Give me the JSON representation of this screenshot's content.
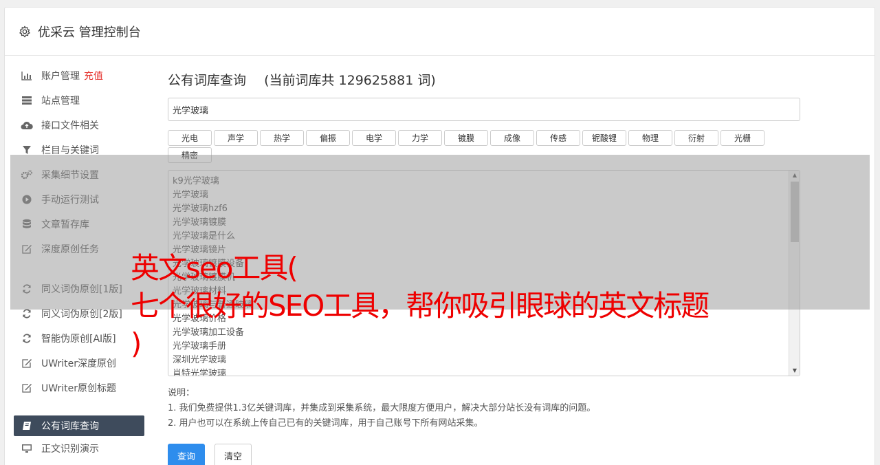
{
  "header": {
    "title": "优采云 管理控制台",
    "icon": "gear-icon"
  },
  "sidebar": {
    "items": [
      {
        "label": "账户管理",
        "extra": "充值",
        "icon": "bar-chart-icon"
      },
      {
        "label": "站点管理",
        "icon": "server-icon"
      },
      {
        "label": "接口文件相关",
        "icon": "cloud-upload-icon"
      },
      {
        "label": "栏目与关键词",
        "icon": "filter-icon"
      },
      {
        "label": "采集细节设置",
        "icon": "gears-icon"
      },
      {
        "label": "手动运行测试",
        "icon": "play-circle-icon"
      },
      {
        "label": "文章暂存库",
        "icon": "database-icon"
      },
      {
        "label": "深度原创任务",
        "icon": "edit-icon"
      },
      {
        "label": "同义词伪原创[1版]",
        "icon": "refresh-icon"
      },
      {
        "label": "同义词伪原创[2版]",
        "icon": "refresh-icon"
      },
      {
        "label": "智能伪原创[AI版]",
        "icon": "refresh-icon"
      },
      {
        "label": "UWriter深度原创",
        "icon": "edit-icon"
      },
      {
        "label": "UWriter原创标题",
        "icon": "edit-icon"
      },
      {
        "label": "公有词库查询",
        "icon": "book-icon",
        "active": true
      },
      {
        "label": "正文识别演示",
        "icon": "monitor-icon"
      }
    ]
  },
  "main": {
    "title": "公有词库查询",
    "count_text": "(当前词库共 129625881 词)",
    "search_value": "光学玻璃",
    "tags": [
      "光电",
      "声学",
      "热学",
      "偏振",
      "电学",
      "力学",
      "镀膜",
      "成像",
      "传感",
      "铌酸锂",
      "物理",
      "衍射",
      "光栅",
      "精密"
    ],
    "results": [
      "k9光学玻璃",
      "光学玻璃",
      "光学玻璃hzf6",
      "光学玻璃镀膜",
      "光学玻璃是什么",
      "光学玻璃镜片",
      "光学玻璃镀膜设备",
      "光学玻璃镀膜机",
      "光学玻璃材料",
      "光学玻璃与普通玻璃",
      "光学玻璃价格",
      "光学玻璃加工设备",
      "光学玻璃手册",
      "深圳光学玻璃",
      "肖特光学玻璃"
    ],
    "notes_title": "说明：",
    "notes": [
      "1. 我们免费提供1.3亿关键词库，并集成到采集系统，最大限度方便用户，解决大部分站长没有词库的问题。",
      "2. 用户也可以在系统上传自己已有的关键词库，用于自己账号下所有网站采集。"
    ],
    "query_button": "查询",
    "clear_button": "清空"
  },
  "overlay": {
    "lines": [
      "英文seo工具(",
      "七个很好的SEO工具，帮你吸引眼球的英文标题",
      ")"
    ]
  },
  "colors": {
    "accent": "#2e8ded",
    "sidebar_active": "#3e4b5c",
    "headline": "#ee0000",
    "recharge": "#e5322d"
  }
}
